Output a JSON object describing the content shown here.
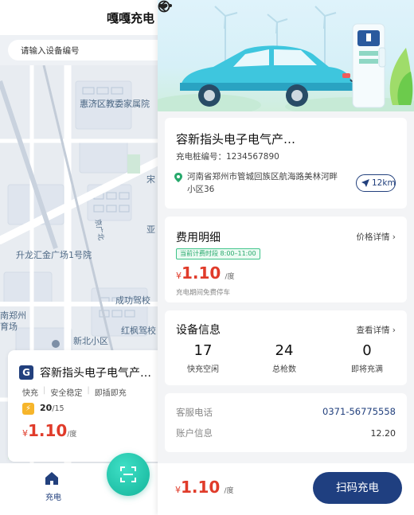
{
  "left_screen": {
    "title": "嘎嘎充电",
    "search_placeholder": "请输入设备编号",
    "map_labels": [
      "惠济区教委家属院",
      "升龙汇金广场1号院",
      "南郑州育场",
      "新北小区",
      "成功驾校",
      "红枫驾校",
      "京广北",
      "宋",
      "亚"
    ],
    "card": {
      "logo": "G",
      "name": "容新指头电子电气产…",
      "tags": [
        "快充",
        "安全稳定",
        "即插即充"
      ],
      "available": "20",
      "total": "/15",
      "currency": "¥",
      "price": "1.10",
      "unit": "/度"
    },
    "tab_home_label": "充电"
  },
  "right_screen": {
    "station": {
      "name": "容新指头电子电气产…",
      "pile_no": "充电桩编号：1234567890",
      "address": "河南省郑州市管城回族区航海路美林河畔小区36",
      "distance": "12km"
    },
    "fee": {
      "title": "费用明细",
      "link": "价格详情",
      "period": "当前计费时段 8:00–11:00",
      "currency": "¥",
      "price": "1.10",
      "unit": "/度",
      "note": "充电期间免费停车"
    },
    "device": {
      "title": "设备信息",
      "link": "查看详情",
      "stats": [
        {
          "value": "17",
          "label": "快充空闲"
        },
        {
          "value": "24",
          "label": "总枪数"
        },
        {
          "value": "0",
          "label": "即将充满"
        }
      ]
    },
    "service": {
      "phone_label": "客服电话",
      "phone_value": "0371-56775558",
      "account_label": "账户信息",
      "account_value": "12.20"
    },
    "bottom": {
      "currency": "¥",
      "price": "1.10",
      "unit": "/度",
      "button": "扫码充电"
    }
  },
  "colors": {
    "brand": "#1f3f80",
    "price": "#e03b2a",
    "accent_green": "#26a86b",
    "scan_button": "#13b39a"
  },
  "icons": [
    "back-icon",
    "more-icon",
    "target-icon",
    "location-pin-icon",
    "navigation-arrow-icon",
    "chevron-right-icon",
    "home-icon",
    "scan-icon",
    "lightning-badge-icon"
  ]
}
